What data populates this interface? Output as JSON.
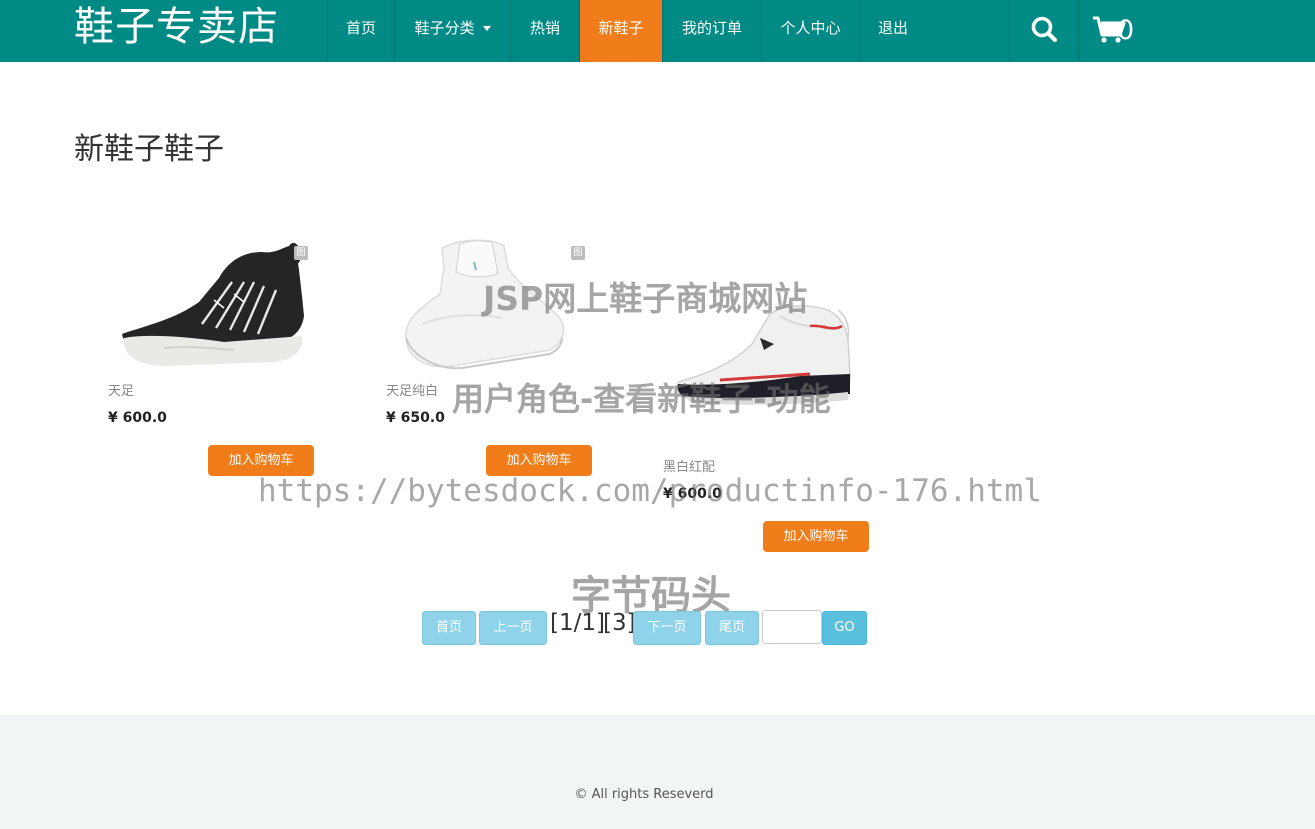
{
  "brand": {
    "title": "鞋子专卖店"
  },
  "nav": {
    "items": [
      {
        "label": "首页"
      },
      {
        "label": "鞋子分类"
      },
      {
        "label": "热销"
      },
      {
        "label": "新鞋子"
      },
      {
        "label": "我的订单"
      },
      {
        "label": "个人中心"
      },
      {
        "label": "退出"
      }
    ],
    "active_index": 3,
    "cart_count": "0"
  },
  "page": {
    "title": "新鞋子鞋子"
  },
  "products": [
    {
      "name": "天足",
      "price": "¥ 600.0",
      "button": "加入购物车",
      "badge": "图"
    },
    {
      "name": "天足纯白",
      "price": "¥ 650.0",
      "button": "加入购物车",
      "badge": "图"
    },
    {
      "name": "黑白红配",
      "price": "¥ 600.0",
      "button": "加入购物车"
    }
  ],
  "pagination": {
    "first": "首页",
    "prev": "上一页",
    "page_info": "[1/1]",
    "total": "[3]",
    "next": "下一页",
    "last": "尾页",
    "input_value": "",
    "go": "GO"
  },
  "watermarks": {
    "line1": "JSP网上鞋子商城网站",
    "line2": "用户角色-查看新鞋子-功能",
    "line3": "https://bytesdock.com/productinfo-176.html",
    "line4": "字节码头"
  },
  "footer": {
    "copyright": "© All rights Reseverd"
  },
  "colors": {
    "navbar": "#008a86",
    "accent": "#f07c1a",
    "pager": "#8fd3ea",
    "go": "#5bc0de"
  }
}
